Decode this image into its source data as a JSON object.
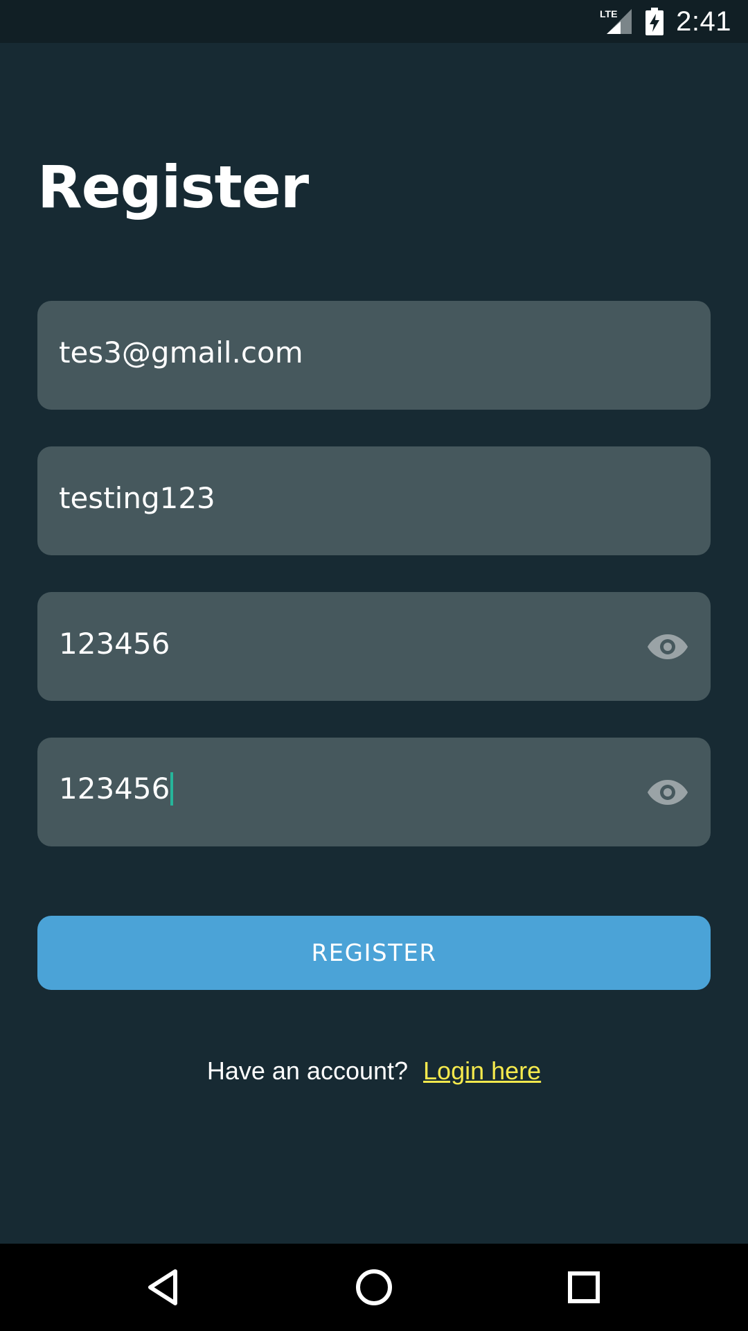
{
  "status_bar": {
    "time": "2:41",
    "network": "LTE"
  },
  "page": {
    "title": "Register"
  },
  "form": {
    "email_value": "tes3@gmail.com",
    "username_value": "testing123",
    "password_value": "123456",
    "confirm_password_value": "123456",
    "register_label": "REGISTER"
  },
  "footer": {
    "prompt": "Have an account?",
    "login_link": "Login here"
  },
  "colors": {
    "background": "#172a33",
    "field": "#46585d",
    "button": "#4ba3d7",
    "link": "#f5e94d",
    "cursor": "#26b59a"
  },
  "icons": [
    "lte-signal-icon",
    "battery-charging-icon",
    "eye-icon",
    "back-icon",
    "home-icon",
    "recents-icon"
  ]
}
